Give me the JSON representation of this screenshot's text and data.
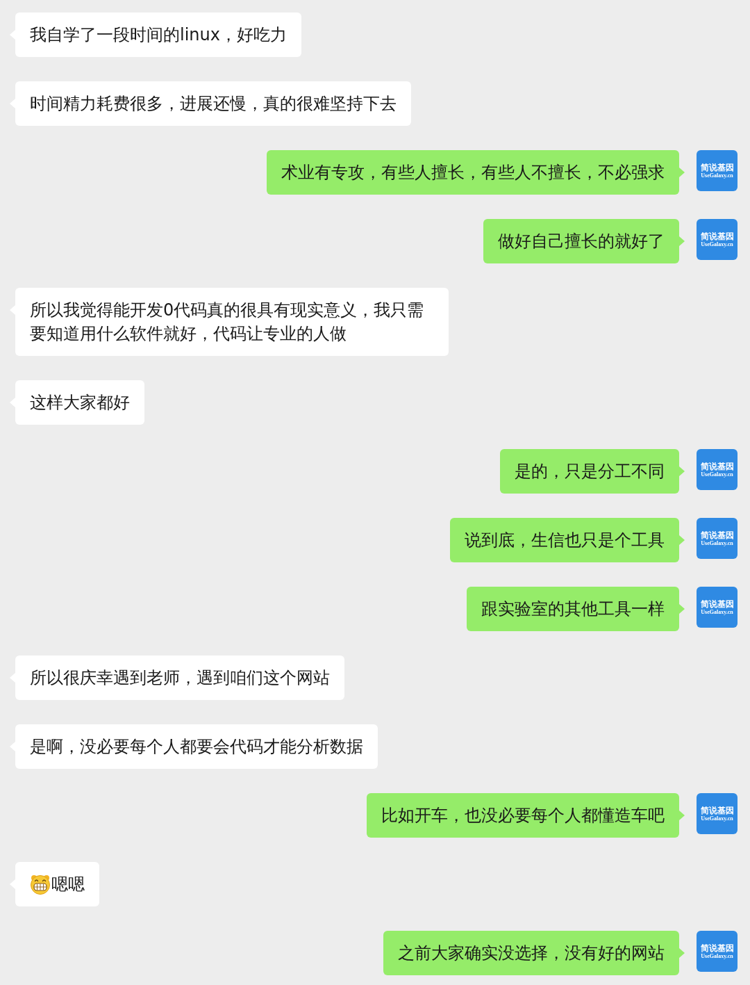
{
  "messages": [
    {
      "kind": "received",
      "text": "我自学了一段时间的linux，好吃力"
    },
    {
      "kind": "received",
      "text": "时间精力耗费很多，进展还慢，真的很难坚持下去"
    },
    {
      "kind": "sent",
      "text": "术业有专攻，有些人擅长，有些人不擅长，不必强求",
      "avatar": {
        "title": "简说基因",
        "subtitle": "UseGalaxy.cn"
      }
    },
    {
      "kind": "sent",
      "text": "做好自己擅长的就好了",
      "avatar": {
        "title": "简说基因",
        "subtitle": "UseGalaxy.cn"
      }
    },
    {
      "kind": "received",
      "text": "所以我觉得能开发0代码真的很具有现实意义，我只需要知道用什么软件就好，代码让专业的人做"
    },
    {
      "kind": "received",
      "text": "这样大家都好"
    },
    {
      "kind": "sent",
      "text": "是的，只是分工不同",
      "avatar": {
        "title": "简说基因",
        "subtitle": "UseGalaxy.cn"
      }
    },
    {
      "kind": "sent",
      "text": "说到底，生信也只是个工具",
      "avatar": {
        "title": "简说基因",
        "subtitle": "UseGalaxy.cn"
      }
    },
    {
      "kind": "sent",
      "text": "跟实验室的其他工具一样",
      "avatar": {
        "title": "简说基因",
        "subtitle": "UseGalaxy.cn"
      }
    },
    {
      "kind": "received",
      "text": "所以很庆幸遇到老师，遇到咱们这个网站"
    },
    {
      "kind": "received",
      "text": "是啊，没必要每个人都要会代码才能分析数据"
    },
    {
      "kind": "sent",
      "text": "比如开车，也没必要每个人都懂造车吧",
      "avatar": {
        "title": "简说基因",
        "subtitle": "UseGalaxy.cn"
      }
    },
    {
      "kind": "received",
      "text": "嗯嗯",
      "emoji": true
    },
    {
      "kind": "sent",
      "text": "之前大家确实没选择，没有好的网站",
      "avatar": {
        "title": "简说基因",
        "subtitle": "UseGalaxy.cn"
      }
    }
  ]
}
